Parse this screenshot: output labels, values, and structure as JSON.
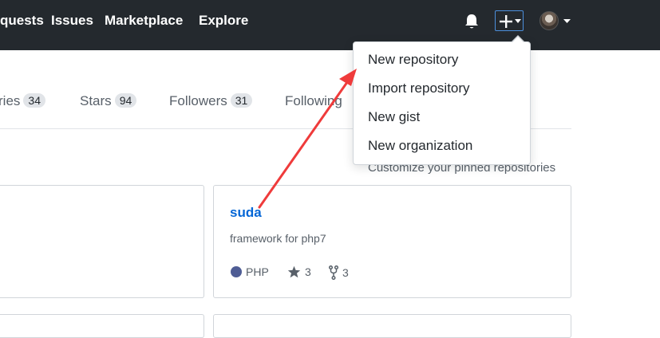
{
  "header": {
    "nav": [
      "quests",
      "Issues",
      "Marketplace",
      "Explore"
    ],
    "icons": [
      "bell-icon",
      "plus-icon",
      "caret-down-icon"
    ],
    "colors": {
      "background": "#24292e",
      "text": "#ffffff",
      "focus_border": "#4c8fdc"
    }
  },
  "tabs": [
    {
      "label": "ries",
      "count": "34"
    },
    {
      "label": "Stars",
      "count": "94"
    },
    {
      "label": "Followers",
      "count": "31"
    },
    {
      "label": "Following",
      "count": ""
    }
  ],
  "dropdown": {
    "items": [
      "New repository",
      "Import repository",
      "New gist",
      "New organization"
    ]
  },
  "pinned": {
    "customize": "Customize your pinned repositories",
    "repo": {
      "name": "suda",
      "description": "framework for php7",
      "language": "PHP",
      "language_color": "#4F5D95",
      "stars": "3",
      "forks": "3"
    }
  },
  "annotation": {
    "arrow_color": "#ef3b3b"
  }
}
